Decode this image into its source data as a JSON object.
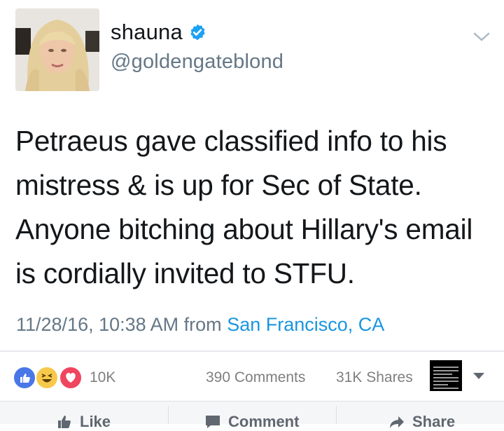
{
  "tweet": {
    "name": "shauna",
    "handle": "@goldengateblond",
    "text": "Petraeus gave classified info to his mistress & is up for Sec of State. Anyone bitching about Hillary's email is cordially invited to STFU.",
    "timestamp": "11/28/16, 10:38 AM from ",
    "location": "San Francisco, CA",
    "verified": true
  },
  "facebook": {
    "reaction_count": "10K",
    "comments": "390 Comments",
    "shares": "31K Shares",
    "actions": {
      "like": "Like",
      "comment": "Comment",
      "share": "Share"
    }
  },
  "colors": {
    "verified_blue": "#1da1f2",
    "link_blue": "#1b95e0",
    "like_reaction": "#4a77e8",
    "haha_reaction": "#f7c94b",
    "love_reaction": "#f0455f"
  }
}
